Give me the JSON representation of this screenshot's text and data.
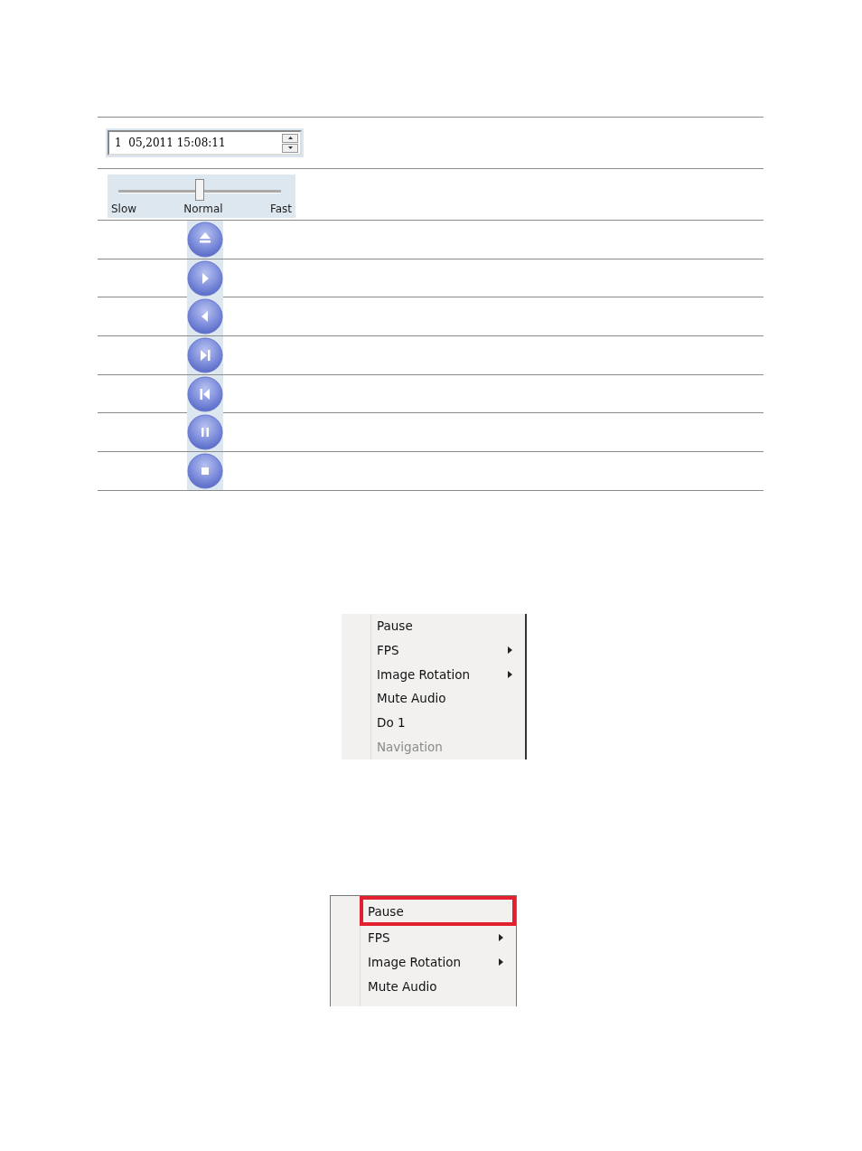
{
  "controls_table": {
    "datetime_field": {
      "value": "1  05,2011 15:08:11"
    },
    "speed_slider": {
      "level": 0.5,
      "labels": [
        "Slow",
        "Normal",
        "Fast"
      ]
    },
    "buttons": [
      {
        "kind": "eject"
      },
      {
        "kind": "play"
      },
      {
        "kind": "reverse"
      },
      {
        "kind": "step-forward"
      },
      {
        "kind": "step-back"
      },
      {
        "kind": "pause"
      },
      {
        "kind": "stop"
      }
    ]
  },
  "context_menu_1": {
    "items": [
      {
        "label": "Pause",
        "submenu": false,
        "disabled": false
      },
      {
        "label": "FPS",
        "submenu": true,
        "disabled": false
      },
      {
        "label": "Image Rotation",
        "submenu": true,
        "disabled": false
      },
      {
        "label": "Mute Audio",
        "submenu": false,
        "disabled": false
      },
      {
        "label": "Do 1",
        "submenu": false,
        "disabled": false
      },
      {
        "label": "Navigation",
        "submenu": false,
        "disabled": true
      }
    ]
  },
  "context_menu_2": {
    "items": [
      {
        "label": "Pause",
        "submenu": false,
        "highlighted": true
      },
      {
        "label": "FPS",
        "submenu": true,
        "highlighted": false
      },
      {
        "label": "Image Rotation",
        "submenu": true,
        "highlighted": false
      },
      {
        "label": "Mute Audio",
        "submenu": false,
        "highlighted": false
      }
    ]
  }
}
